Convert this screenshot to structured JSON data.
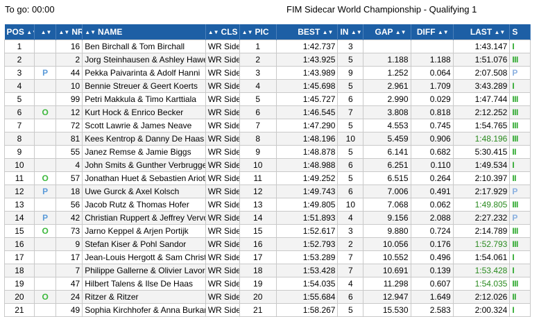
{
  "header": {
    "to_go": "To go: 00:00",
    "title": "FIM Sidecar World Championship - Qualifying 1"
  },
  "colors": {
    "header_bg": "#1d5fa5",
    "fast_lap": "#2a8a1f",
    "status_green": "#2ba82b",
    "pit_blue": "#5b9bd9"
  },
  "columns": [
    {
      "key": "pos",
      "label": "POS"
    },
    {
      "key": "pit",
      "label": ""
    },
    {
      "key": "nr",
      "label": "NR"
    },
    {
      "key": "name",
      "label": "NAME"
    },
    {
      "key": "cls",
      "label": "CLS"
    },
    {
      "key": "pic",
      "label": "PIC"
    },
    {
      "key": "best",
      "label": "BEST"
    },
    {
      "key": "in",
      "label": "IN"
    },
    {
      "key": "gap",
      "label": "GAP"
    },
    {
      "key": "diff",
      "label": "DIFF"
    },
    {
      "key": "last",
      "label": "LAST"
    },
    {
      "key": "s",
      "label": "S"
    }
  ],
  "rows": [
    {
      "pos": "1",
      "pit": "",
      "nr": "16",
      "name": "Ben Birchall & Tom Birchall",
      "cls": "WR Side",
      "pic": "1",
      "best": "1:42.737",
      "in": "3",
      "gap": "",
      "diff": "",
      "last": "1:43.147",
      "last_fast": false,
      "s": "I"
    },
    {
      "pos": "2",
      "pit": "",
      "nr": "2",
      "name": "Jorg Steinhausen & Ashley Hawes",
      "cls": "WR Side",
      "pic": "2",
      "best": "1:43.925",
      "in": "5",
      "gap": "1.188",
      "diff": "1.188",
      "last": "1:51.076",
      "last_fast": false,
      "s": "III"
    },
    {
      "pos": "3",
      "pit": "P",
      "nr": "44",
      "name": "Pekka Paivarinta & Adolf Hanni",
      "cls": "WR Side",
      "pic": "3",
      "best": "1:43.989",
      "in": "9",
      "gap": "1.252",
      "diff": "0.064",
      "last": "2:07.508",
      "last_fast": false,
      "s": "P"
    },
    {
      "pos": "4",
      "pit": "",
      "nr": "10",
      "name": "Bennie Streuer & Geert Koerts",
      "cls": "WR Side",
      "pic": "4",
      "best": "1:45.698",
      "in": "5",
      "gap": "2.961",
      "diff": "1.709",
      "last": "3:43.289",
      "last_fast": false,
      "s": "I"
    },
    {
      "pos": "5",
      "pit": "",
      "nr": "99",
      "name": "Petri Makkula & Timo Karttiala",
      "cls": "WR Side",
      "pic": "5",
      "best": "1:45.727",
      "in": "6",
      "gap": "2.990",
      "diff": "0.029",
      "last": "1:47.744",
      "last_fast": false,
      "s": "III"
    },
    {
      "pos": "6",
      "pit": "O",
      "nr": "12",
      "name": "Kurt Hock & Enrico Becker",
      "cls": "WR Side",
      "pic": "6",
      "best": "1:46.545",
      "in": "7",
      "gap": "3.808",
      "diff": "0.818",
      "last": "2:12.252",
      "last_fast": false,
      "s": "III"
    },
    {
      "pos": "7",
      "pit": "",
      "nr": "72",
      "name": "Scott Lawrie & James Neave",
      "cls": "WR Side",
      "pic": "7",
      "best": "1:47.290",
      "in": "5",
      "gap": "4.553",
      "diff": "0.745",
      "last": "1:54.765",
      "last_fast": false,
      "s": "III"
    },
    {
      "pos": "8",
      "pit": "",
      "nr": "81",
      "name": "Kees Kentrop & Danny De Haas",
      "cls": "WR Side",
      "pic": "8",
      "best": "1:48.196",
      "in": "10",
      "gap": "5.459",
      "diff": "0.906",
      "last": "1:48.196",
      "last_fast": true,
      "s": "III"
    },
    {
      "pos": "9",
      "pit": "",
      "nr": "55",
      "name": "Janez Remse & Jamie Biggs",
      "cls": "WR Side",
      "pic": "9",
      "best": "1:48.878",
      "in": "5",
      "gap": "6.141",
      "diff": "0.682",
      "last": "5:30.415",
      "last_fast": false,
      "s": "II"
    },
    {
      "pos": "10",
      "pit": "",
      "nr": "4",
      "name": "John Smits & Gunther Verbruggen",
      "cls": "WR Side",
      "pic": "10",
      "best": "1:48.988",
      "in": "6",
      "gap": "6.251",
      "diff": "0.110",
      "last": "1:49.534",
      "last_fast": false,
      "s": "I"
    },
    {
      "pos": "11",
      "pit": "O",
      "nr": "57",
      "name": "Jonathan Huet & Sebastien Ariot",
      "cls": "WR Side",
      "pic": "11",
      "best": "1:49.252",
      "in": "5",
      "gap": "6.515",
      "diff": "0.264",
      "last": "2:10.397",
      "last_fast": false,
      "s": "II"
    },
    {
      "pos": "12",
      "pit": "P",
      "nr": "18",
      "name": "Uwe Gurck & Axel Kolsch",
      "cls": "WR Side",
      "pic": "12",
      "best": "1:49.743",
      "in": "6",
      "gap": "7.006",
      "diff": "0.491",
      "last": "2:17.929",
      "last_fast": false,
      "s": "P"
    },
    {
      "pos": "13",
      "pit": "",
      "nr": "56",
      "name": "Jacob Rutz & Thomas Hofer",
      "cls": "WR Side",
      "pic": "13",
      "best": "1:49.805",
      "in": "10",
      "gap": "7.068",
      "diff": "0.062",
      "last": "1:49.805",
      "last_fast": true,
      "s": "III"
    },
    {
      "pos": "14",
      "pit": "P",
      "nr": "42",
      "name": "Christian Ruppert & Jeffrey Vervoort",
      "cls": "WR Side",
      "pic": "14",
      "best": "1:51.893",
      "in": "4",
      "gap": "9.156",
      "diff": "2.088",
      "last": "2:27.232",
      "last_fast": false,
      "s": "P"
    },
    {
      "pos": "15",
      "pit": "O",
      "nr": "73",
      "name": "Jarno Keppel & Arjen Portijk",
      "cls": "WR Side",
      "pic": "15",
      "best": "1:52.617",
      "in": "3",
      "gap": "9.880",
      "diff": "0.724",
      "last": "2:14.789",
      "last_fast": false,
      "s": "III"
    },
    {
      "pos": "16",
      "pit": "",
      "nr": "9",
      "name": "Stefan Kiser & Pohl Sandor",
      "cls": "WR Side",
      "pic": "16",
      "best": "1:52.793",
      "in": "2",
      "gap": "10.056",
      "diff": "0.176",
      "last": "1:52.793",
      "last_fast": true,
      "s": "III"
    },
    {
      "pos": "17",
      "pit": "",
      "nr": "17",
      "name": "Jean-Louis Hergott & Sam Christie",
      "cls": "WR Side",
      "pic": "17",
      "best": "1:53.289",
      "in": "7",
      "gap": "10.552",
      "diff": "0.496",
      "last": "1:54.061",
      "last_fast": false,
      "s": "I"
    },
    {
      "pos": "18",
      "pit": "",
      "nr": "7",
      "name": "Philippe Gallerne & Olivier Lavorel",
      "cls": "WR Side",
      "pic": "18",
      "best": "1:53.428",
      "in": "7",
      "gap": "10.691",
      "diff": "0.139",
      "last": "1:53.428",
      "last_fast": true,
      "s": "I"
    },
    {
      "pos": "19",
      "pit": "",
      "nr": "47",
      "name": "Hilbert Talens & Ilse De Haas",
      "cls": "WR Side",
      "pic": "19",
      "best": "1:54.035",
      "in": "4",
      "gap": "11.298",
      "diff": "0.607",
      "last": "1:54.035",
      "last_fast": true,
      "s": "III"
    },
    {
      "pos": "20",
      "pit": "O",
      "nr": "24",
      "name": "Ritzer & Ritzer",
      "cls": "WR Side",
      "pic": "20",
      "best": "1:55.684",
      "in": "6",
      "gap": "12.947",
      "diff": "1.649",
      "last": "2:12.026",
      "last_fast": false,
      "s": "II"
    },
    {
      "pos": "21",
      "pit": "",
      "nr": "49",
      "name": "Sophia Kirchhofer & Anna Burkard",
      "cls": "WR Side",
      "pic": "21",
      "best": "1:58.267",
      "in": "5",
      "gap": "15.530",
      "diff": "2.583",
      "last": "2:00.324",
      "last_fast": false,
      "s": "I"
    }
  ]
}
